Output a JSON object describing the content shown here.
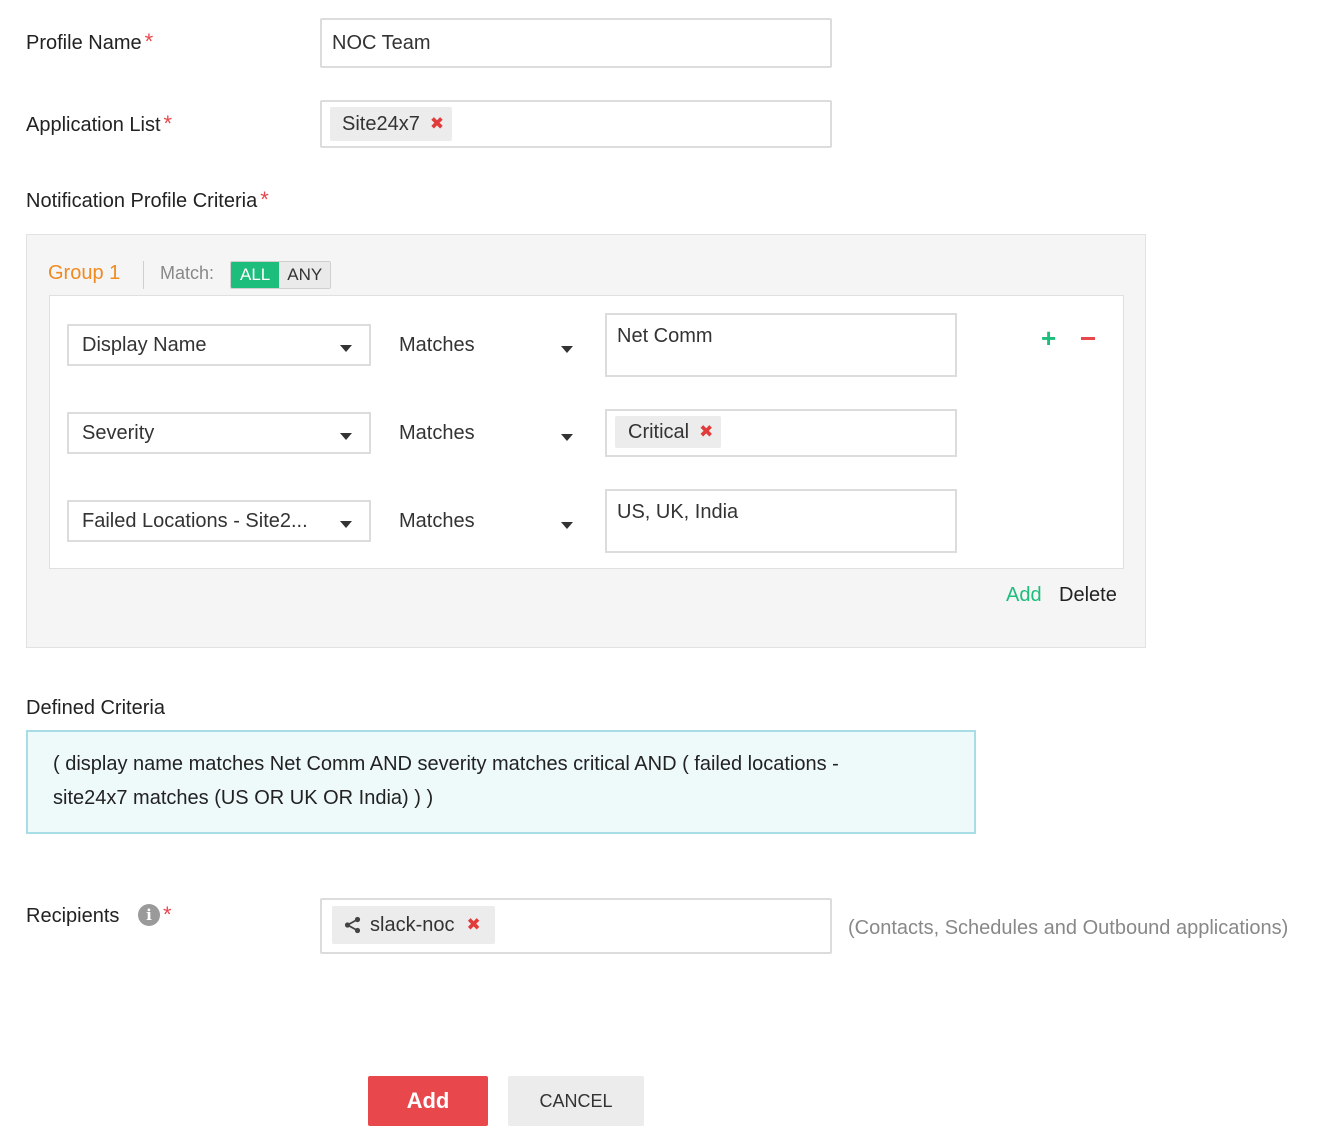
{
  "profile_name": {
    "label": "Profile Name",
    "value": "NOC Team"
  },
  "application_list": {
    "label": "Application List",
    "tags": [
      "Site24x7"
    ]
  },
  "criteria": {
    "label": "Notification Profile Criteria",
    "group": {
      "title": "Group 1",
      "match_label": "Match:",
      "match_options": [
        "ALL",
        "ANY"
      ],
      "match_selected": "ALL",
      "rows": [
        {
          "field": "Display Name",
          "operator": "Matches",
          "value": "Net Comm"
        },
        {
          "field": "Severity",
          "operator": "Matches",
          "value_tag": "Critical"
        },
        {
          "field": "Failed Locations - Site2...",
          "operator": "Matches",
          "value": "US, UK, India"
        }
      ],
      "add_link": "Add",
      "delete_link": "Delete"
    }
  },
  "defined_criteria": {
    "label": "Defined Criteria",
    "line1": "( display name matches Net Comm AND severity matches critical AND ( failed locations -",
    "line2": "site24x7 matches (US OR UK OR India) ) )"
  },
  "recipients": {
    "label": "Recipients",
    "tag": "slack-noc",
    "hint": "(Contacts, Schedules and Outbound applications)"
  },
  "actions": {
    "add": "Add",
    "cancel": "CANCEL"
  },
  "colors": {
    "accent_green": "#1dbd7c",
    "accent_orange": "#f08a21",
    "danger_red": "#e8474c",
    "criteria_bg": "#eef9fa",
    "criteria_border": "#a9dde6"
  }
}
